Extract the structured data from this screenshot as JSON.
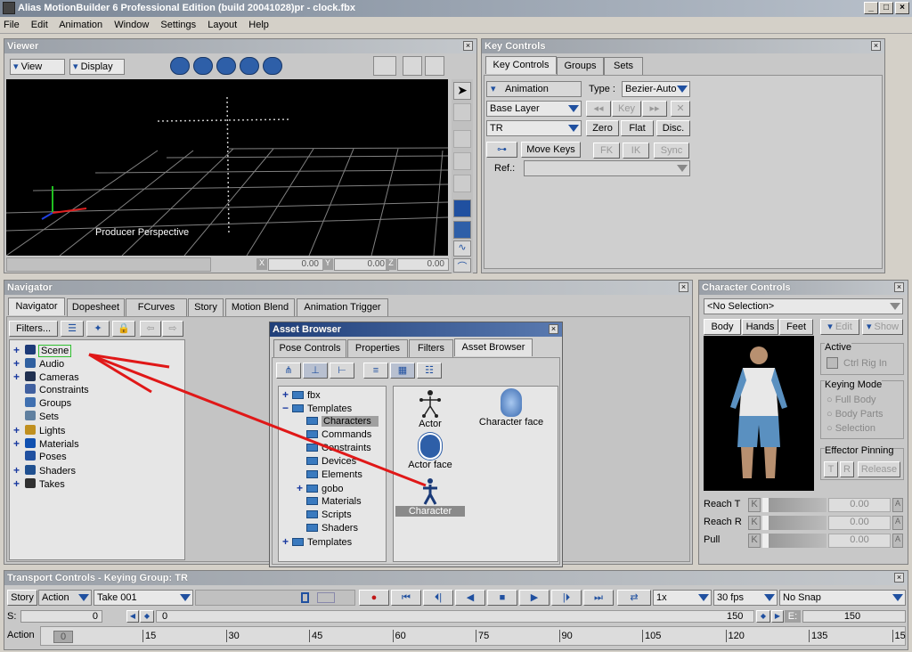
{
  "window": {
    "title": "Alias MotionBuilder 6 Professional Edition (build 20041028)pr - clock.fbx"
  },
  "menu": [
    "File",
    "Edit",
    "Animation",
    "Window",
    "Settings",
    "Layout",
    "Help"
  ],
  "viewer": {
    "title": "Viewer",
    "view_label": "View",
    "display_label": "Display",
    "camera_label": "Producer Perspective",
    "coords": {
      "x_label": "X",
      "x": "0.00",
      "y_label": "Y",
      "y": "0.00",
      "z_label": "Z",
      "z": "0.00"
    }
  },
  "key_controls": {
    "title": "Key Controls",
    "tabs": [
      "Key Controls",
      "Groups",
      "Sets"
    ],
    "animation_label": "Animation",
    "type_label": "Type :",
    "type_value": "Bezier-Auto",
    "layer_value": "Base Layer",
    "key_label": "Key",
    "tr_value": "TR",
    "zero_label": "Zero",
    "flat_label": "Flat",
    "disc_label": "Disc.",
    "move_keys_label": "Move Keys",
    "fk_label": "FK",
    "ik_label": "IK",
    "sync_label": "Sync",
    "ref_label": "Ref.:"
  },
  "navigator": {
    "title": "Navigator",
    "tabs": [
      "Navigator",
      "Dopesheet",
      "FCurves",
      "Story",
      "Motion Blend",
      "Animation Trigger"
    ],
    "filters_label": "Filters...",
    "tree": [
      {
        "label": "Scene",
        "expand": "+",
        "icon_color": "#1c3a78"
      },
      {
        "label": "Audio",
        "expand": "+",
        "icon_color": "#3060a0"
      },
      {
        "label": "Cameras",
        "expand": "+",
        "icon_color": "#203050"
      },
      {
        "label": "Constraints",
        "expand": "",
        "icon_color": "#4060a0"
      },
      {
        "label": "Groups",
        "expand": "",
        "icon_color": "#4070b0"
      },
      {
        "label": "Sets",
        "expand": "",
        "icon_color": "#6080a0"
      },
      {
        "label": "Lights",
        "expand": "+",
        "icon_color": "#c09020"
      },
      {
        "label": "Materials",
        "expand": "+",
        "icon_color": "#1050b0"
      },
      {
        "label": "Poses",
        "expand": "",
        "icon_color": "#2050a0"
      },
      {
        "label": "Shaders",
        "expand": "+",
        "icon_color": "#205090"
      },
      {
        "label": "Takes",
        "expand": "+",
        "icon_color": "#303030"
      }
    ]
  },
  "asset_browser": {
    "title": "Asset Browser",
    "tabs": [
      "Pose Controls",
      "Properties",
      "Filters",
      "Asset Browser"
    ],
    "tree": [
      {
        "label": "fbx",
        "expand": "+",
        "indent": 0
      },
      {
        "label": "Templates",
        "expand": "−",
        "indent": 0
      },
      {
        "label": "Characters",
        "expand": "",
        "indent": 1,
        "selected": true
      },
      {
        "label": "Commands",
        "expand": "",
        "indent": 1
      },
      {
        "label": "Constraints",
        "expand": "",
        "indent": 1
      },
      {
        "label": "Devices",
        "expand": "",
        "indent": 1
      },
      {
        "label": "Elements",
        "expand": "",
        "indent": 1
      },
      {
        "label": "gobo",
        "expand": "+",
        "indent": 1
      },
      {
        "label": "Materials",
        "expand": "",
        "indent": 1
      },
      {
        "label": "Scripts",
        "expand": "",
        "indent": 1
      },
      {
        "label": "Shaders",
        "expand": "",
        "indent": 1
      },
      {
        "label": "Templates",
        "expand": "+",
        "indent": 0
      }
    ],
    "assets": [
      "Actor",
      "Character face",
      "Actor face",
      "Character"
    ]
  },
  "character_controls": {
    "title": "Character Controls",
    "selection": "<No Selection>",
    "tabs": [
      "Body",
      "Hands",
      "Feet"
    ],
    "edit_label": "Edit",
    "show_label": "Show",
    "active_title": "Active",
    "ctrl_rig_label": "Ctrl Rig In",
    "keying_mode_title": "Keying Mode",
    "keying_options": [
      "Full Body",
      "Body Parts",
      "Selection"
    ],
    "effector_title": "Effector Pinning",
    "effector_t": "T",
    "effector_r": "R",
    "release_label": "Release",
    "sliders": [
      {
        "label": "Reach T",
        "value": "0.00"
      },
      {
        "label": "Reach R",
        "value": "0.00"
      },
      {
        "label": "Pull",
        "value": "0.00"
      }
    ],
    "k_label": "K",
    "a_label": "A"
  },
  "transport": {
    "title": "Transport Controls  -  Keying Group: TR",
    "story_label": "Story",
    "action_label": "Action",
    "take_value": "Take 001",
    "speed_value": "1x",
    "fps_value": "30 fps",
    "snap_value": "No Snap",
    "start_label": "S:",
    "start_value": "0",
    "current_value": "0",
    "end_value_marker": "150",
    "end_label": "E:",
    "end_value": "150",
    "ruler_label": "Action",
    "ruler_current": "0",
    "ticks": [
      "15",
      "30",
      "45",
      "60",
      "75",
      "90",
      "105",
      "120",
      "135",
      "15"
    ]
  }
}
